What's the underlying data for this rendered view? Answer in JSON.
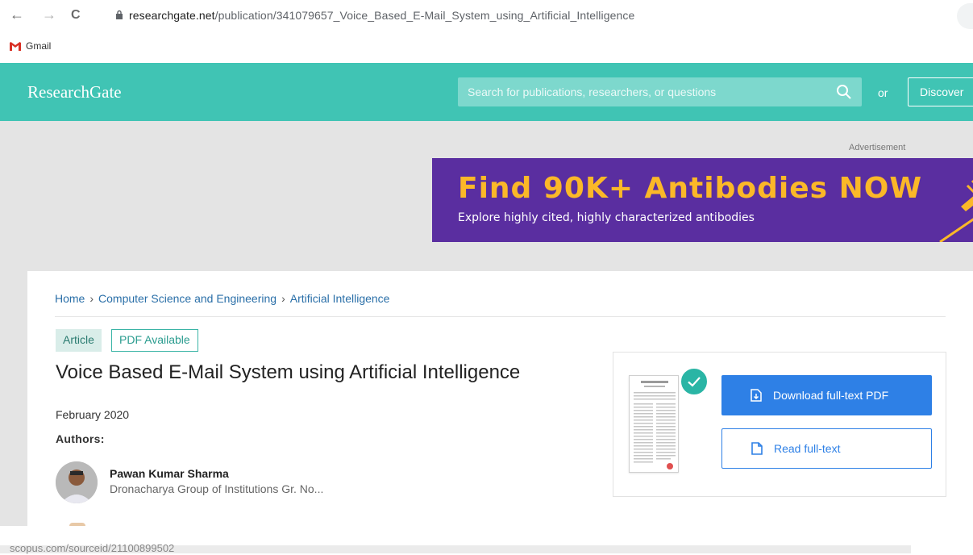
{
  "browser": {
    "url_host": "researchgate.net",
    "url_path": "/publication/341079657_Voice_Based_E-Mail_System_using_Artificial_Intelligence",
    "back_glyph": "←",
    "forward_glyph": "→",
    "reload_glyph": "C",
    "bookmarks": [
      {
        "label": "Gmail",
        "icon": "gmail-icon"
      }
    ]
  },
  "header": {
    "logo": "ResearchGate",
    "search_placeholder": "Search for publications, researchers, or questions",
    "or_text": "or",
    "discover_label": "Discover"
  },
  "ad": {
    "label": "Advertisement",
    "headline": "Find 90K+ Antibodies NOW",
    "subtext": "Explore highly cited, highly characterized antibodies"
  },
  "publication": {
    "breadcrumb": [
      "Home",
      "Computer Science and Engineering",
      "Artificial Intelligence"
    ],
    "breadcrumb_sep": "›",
    "type_badge": "Article",
    "pdf_badge": "PDF Available",
    "title": "Voice Based E-Mail System using Artificial Intelligence",
    "date": "February 2020",
    "authors_label": "Authors:",
    "authors": [
      {
        "name": "Pawan Kumar Sharma",
        "affiliation": "Dronacharya Group of Institutions Gr. No..."
      }
    ]
  },
  "actions": {
    "download_label": "Download full-text PDF",
    "read_label": "Read full-text"
  },
  "footer": {
    "url": "scopus.com/sourceid/21100899502"
  },
  "colors": {
    "header_bg": "#40c4b4",
    "accent_blue": "#2e80e6",
    "ad_bg": "#5a2ea0",
    "ad_headline": "#fbb828",
    "badge_teal": "#2ab5a5"
  }
}
